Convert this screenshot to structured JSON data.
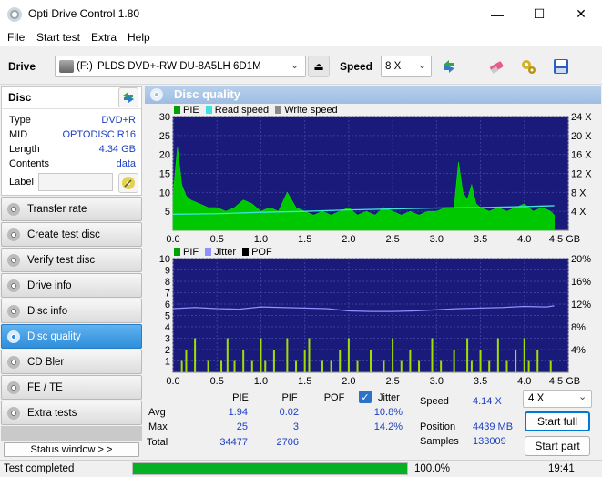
{
  "window": {
    "title": "Opti Drive Control 1.80",
    "minimize": "—",
    "maximize": "☐",
    "close": "✕"
  },
  "menu": [
    "File",
    "Start test",
    "Extra",
    "Help"
  ],
  "drivebar": {
    "drive_label": "Drive",
    "drive_letter": "(F:)",
    "drive_name": "PLDS DVD+-RW DU-8A5LH 6D1M",
    "speed_label": "Speed",
    "speed_value": "8 X"
  },
  "disc": {
    "heading": "Disc",
    "rows": [
      {
        "key": "Type",
        "value": "DVD+R"
      },
      {
        "key": "MID",
        "value": "OPTODISC R16"
      },
      {
        "key": "Length",
        "value": "4.34 GB"
      },
      {
        "key": "Contents",
        "value": "data"
      }
    ],
    "label_key": "Label",
    "label_value": ""
  },
  "nav": [
    {
      "label": "Transfer rate",
      "active": false
    },
    {
      "label": "Create test disc",
      "active": false
    },
    {
      "label": "Verify test disc",
      "active": false
    },
    {
      "label": "Drive info",
      "active": false
    },
    {
      "label": "Disc info",
      "active": false
    },
    {
      "label": "Disc quality",
      "active": true
    },
    {
      "label": "CD Bler",
      "active": false
    },
    {
      "label": "FE / TE",
      "active": false
    },
    {
      "label": "Extra tests",
      "active": false
    }
  ],
  "status_window_button": "Status window > >",
  "panel_title": "Disc quality",
  "chart_data": [
    {
      "type": "area",
      "legend": [
        "PIE",
        "Read speed",
        "Write speed"
      ],
      "colors": {
        "pie": "#00c800",
        "read": "#40e0e0",
        "write": "#8a8a8a",
        "background": "#1a1a7a"
      },
      "x_ticks": [
        "0.0",
        "0.5",
        "1.0",
        "1.5",
        "2.0",
        "2.5",
        "3.0",
        "3.5",
        "4.0",
        "4.5 GB"
      ],
      "y_left_ticks": [
        "30",
        "25",
        "20",
        "15",
        "10",
        "5"
      ],
      "y_right_ticks": [
        "24 X",
        "20 X",
        "16 X",
        "12 X",
        "8 X",
        "4 X"
      ],
      "xlim": [
        0,
        4.5
      ],
      "ylim": [
        0,
        30
      ],
      "y2lim": [
        0,
        24
      ],
      "pie_series": {
        "x": [
          0.0,
          0.05,
          0.1,
          0.15,
          0.2,
          0.3,
          0.4,
          0.5,
          0.6,
          0.7,
          0.8,
          0.9,
          1.0,
          1.1,
          1.2,
          1.3,
          1.4,
          1.5,
          1.6,
          1.7,
          1.8,
          1.9,
          2.0,
          2.1,
          2.2,
          2.3,
          2.4,
          2.5,
          2.6,
          2.7,
          2.8,
          2.9,
          3.0,
          3.1,
          3.2,
          3.25,
          3.3,
          3.35,
          3.4,
          3.45,
          3.5,
          3.6,
          3.7,
          3.8,
          3.9,
          4.0,
          4.1,
          4.2,
          4.3,
          4.34
        ],
        "y": [
          9,
          22,
          12,
          9,
          8,
          7,
          6,
          6,
          5,
          6,
          8,
          7,
          5,
          6,
          5,
          10,
          6,
          5,
          4,
          5,
          4,
          5,
          6,
          4,
          5,
          4,
          6,
          5,
          4,
          5,
          4,
          5,
          5,
          6,
          6,
          18,
          10,
          8,
          12,
          7,
          6,
          5,
          6,
          5,
          6,
          7,
          5,
          6,
          5,
          4
        ]
      },
      "read_speed": {
        "x": [
          0.0,
          0.5,
          1.0,
          1.5,
          2.0,
          2.5,
          3.0,
          3.5,
          4.0,
          4.34
        ],
        "y": [
          3.4,
          3.5,
          3.8,
          4.0,
          4.3,
          4.5,
          4.7,
          4.8,
          5.0,
          5.2
        ]
      }
    },
    {
      "type": "bar",
      "legend": [
        "PIF",
        "Jitter",
        "POF"
      ],
      "colors": {
        "pif": "#a0e000",
        "jitter": "#9090ff",
        "pof": "#000000",
        "background": "#1a1a7a"
      },
      "x_ticks": [
        "0.0",
        "0.5",
        "1.0",
        "1.5",
        "2.0",
        "2.5",
        "3.0",
        "3.5",
        "4.0",
        "4.5 GB"
      ],
      "y_left_ticks": [
        "10",
        "9",
        "8",
        "7",
        "6",
        "5",
        "4",
        "3",
        "2",
        "1"
      ],
      "y_right_ticks": [
        "20%",
        "16%",
        "12%",
        "8%",
        "4%"
      ],
      "xlim": [
        0,
        4.5
      ],
      "ylim": [
        0,
        10
      ],
      "y2lim": [
        0,
        20
      ],
      "pif_series": {
        "x": [
          0.1,
          0.15,
          0.25,
          0.4,
          0.55,
          0.62,
          0.7,
          0.8,
          0.9,
          1.0,
          1.05,
          1.15,
          1.3,
          1.4,
          1.5,
          1.55,
          1.7,
          1.8,
          1.9,
          2.0,
          2.1,
          2.25,
          2.4,
          2.5,
          2.6,
          2.7,
          2.8,
          2.95,
          3.05,
          3.2,
          3.35,
          3.4,
          3.5,
          3.6,
          3.7,
          3.8,
          3.9,
          4.0,
          4.05,
          4.15,
          4.3
        ],
        "y": [
          1,
          2,
          3,
          1,
          1,
          3,
          1,
          2,
          1,
          3,
          1,
          2,
          3,
          1,
          2,
          3,
          1,
          1,
          2,
          3,
          1,
          2,
          1,
          3,
          1,
          2,
          1,
          3,
          1,
          2,
          3,
          1,
          2,
          1,
          3,
          1,
          2,
          3,
          1,
          2,
          1
        ]
      },
      "jitter_series": {
        "x": [
          0.0,
          0.25,
          0.5,
          0.75,
          1.0,
          1.25,
          1.5,
          1.75,
          2.0,
          2.25,
          2.5,
          2.75,
          3.0,
          3.25,
          3.5,
          3.75,
          4.0,
          4.25,
          4.34
        ],
        "y": [
          11.2,
          11.4,
          11.2,
          11.1,
          11.5,
          11.4,
          11.3,
          11.2,
          10.8,
          10.7,
          10.7,
          10.8,
          11.0,
          11.2,
          11.3,
          11.4,
          11.6,
          11.5,
          11.7
        ]
      }
    }
  ],
  "stats": {
    "headers": {
      "pie": "PIE",
      "pif": "PIF",
      "pof": "POF",
      "jitter": "Jitter"
    },
    "rows": [
      {
        "label": "Avg",
        "pie": "1.94",
        "pif": "0.02",
        "jitter": "10.8%"
      },
      {
        "label": "Max",
        "pie": "25",
        "pif": "3",
        "jitter": "14.2%"
      },
      {
        "label": "Total",
        "pie": "34477",
        "pif": "2706"
      }
    ],
    "jitter_checked": true,
    "speed_label": "Speed",
    "speed_value": "4.14 X",
    "position_label": "Position",
    "position_value": "4439 MB",
    "samples_label": "Samples",
    "samples_value": "133009",
    "speed_select": "4 X",
    "start_full": "Start full",
    "start_part": "Start part"
  },
  "statusbar": {
    "text": "Test completed",
    "progress": 1.0,
    "progress_text": "100.0%",
    "time": "19:41"
  }
}
